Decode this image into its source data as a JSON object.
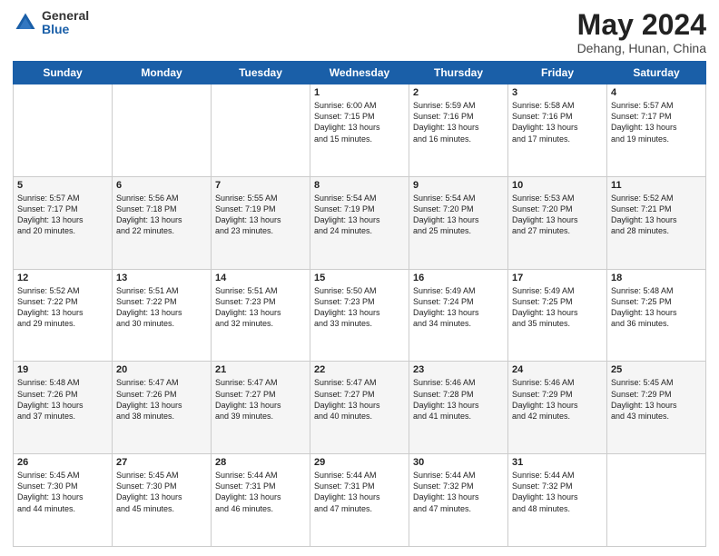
{
  "header": {
    "logo_general": "General",
    "logo_blue": "Blue",
    "month_year": "May 2024",
    "location": "Dehang, Hunan, China"
  },
  "days_of_week": [
    "Sunday",
    "Monday",
    "Tuesday",
    "Wednesday",
    "Thursday",
    "Friday",
    "Saturday"
  ],
  "weeks": [
    [
      {
        "day": "",
        "info": ""
      },
      {
        "day": "",
        "info": ""
      },
      {
        "day": "",
        "info": ""
      },
      {
        "day": "1",
        "info": "Sunrise: 6:00 AM\nSunset: 7:15 PM\nDaylight: 13 hours\nand 15 minutes."
      },
      {
        "day": "2",
        "info": "Sunrise: 5:59 AM\nSunset: 7:16 PM\nDaylight: 13 hours\nand 16 minutes."
      },
      {
        "day": "3",
        "info": "Sunrise: 5:58 AM\nSunset: 7:16 PM\nDaylight: 13 hours\nand 17 minutes."
      },
      {
        "day": "4",
        "info": "Sunrise: 5:57 AM\nSunset: 7:17 PM\nDaylight: 13 hours\nand 19 minutes."
      }
    ],
    [
      {
        "day": "5",
        "info": "Sunrise: 5:57 AM\nSunset: 7:17 PM\nDaylight: 13 hours\nand 20 minutes."
      },
      {
        "day": "6",
        "info": "Sunrise: 5:56 AM\nSunset: 7:18 PM\nDaylight: 13 hours\nand 22 minutes."
      },
      {
        "day": "7",
        "info": "Sunrise: 5:55 AM\nSunset: 7:19 PM\nDaylight: 13 hours\nand 23 minutes."
      },
      {
        "day": "8",
        "info": "Sunrise: 5:54 AM\nSunset: 7:19 PM\nDaylight: 13 hours\nand 24 minutes."
      },
      {
        "day": "9",
        "info": "Sunrise: 5:54 AM\nSunset: 7:20 PM\nDaylight: 13 hours\nand 25 minutes."
      },
      {
        "day": "10",
        "info": "Sunrise: 5:53 AM\nSunset: 7:20 PM\nDaylight: 13 hours\nand 27 minutes."
      },
      {
        "day": "11",
        "info": "Sunrise: 5:52 AM\nSunset: 7:21 PM\nDaylight: 13 hours\nand 28 minutes."
      }
    ],
    [
      {
        "day": "12",
        "info": "Sunrise: 5:52 AM\nSunset: 7:22 PM\nDaylight: 13 hours\nand 29 minutes."
      },
      {
        "day": "13",
        "info": "Sunrise: 5:51 AM\nSunset: 7:22 PM\nDaylight: 13 hours\nand 30 minutes."
      },
      {
        "day": "14",
        "info": "Sunrise: 5:51 AM\nSunset: 7:23 PM\nDaylight: 13 hours\nand 32 minutes."
      },
      {
        "day": "15",
        "info": "Sunrise: 5:50 AM\nSunset: 7:23 PM\nDaylight: 13 hours\nand 33 minutes."
      },
      {
        "day": "16",
        "info": "Sunrise: 5:49 AM\nSunset: 7:24 PM\nDaylight: 13 hours\nand 34 minutes."
      },
      {
        "day": "17",
        "info": "Sunrise: 5:49 AM\nSunset: 7:25 PM\nDaylight: 13 hours\nand 35 minutes."
      },
      {
        "day": "18",
        "info": "Sunrise: 5:48 AM\nSunset: 7:25 PM\nDaylight: 13 hours\nand 36 minutes."
      }
    ],
    [
      {
        "day": "19",
        "info": "Sunrise: 5:48 AM\nSunset: 7:26 PM\nDaylight: 13 hours\nand 37 minutes."
      },
      {
        "day": "20",
        "info": "Sunrise: 5:47 AM\nSunset: 7:26 PM\nDaylight: 13 hours\nand 38 minutes."
      },
      {
        "day": "21",
        "info": "Sunrise: 5:47 AM\nSunset: 7:27 PM\nDaylight: 13 hours\nand 39 minutes."
      },
      {
        "day": "22",
        "info": "Sunrise: 5:47 AM\nSunset: 7:27 PM\nDaylight: 13 hours\nand 40 minutes."
      },
      {
        "day": "23",
        "info": "Sunrise: 5:46 AM\nSunset: 7:28 PM\nDaylight: 13 hours\nand 41 minutes."
      },
      {
        "day": "24",
        "info": "Sunrise: 5:46 AM\nSunset: 7:29 PM\nDaylight: 13 hours\nand 42 minutes."
      },
      {
        "day": "25",
        "info": "Sunrise: 5:45 AM\nSunset: 7:29 PM\nDaylight: 13 hours\nand 43 minutes."
      }
    ],
    [
      {
        "day": "26",
        "info": "Sunrise: 5:45 AM\nSunset: 7:30 PM\nDaylight: 13 hours\nand 44 minutes."
      },
      {
        "day": "27",
        "info": "Sunrise: 5:45 AM\nSunset: 7:30 PM\nDaylight: 13 hours\nand 45 minutes."
      },
      {
        "day": "28",
        "info": "Sunrise: 5:44 AM\nSunset: 7:31 PM\nDaylight: 13 hours\nand 46 minutes."
      },
      {
        "day": "29",
        "info": "Sunrise: 5:44 AM\nSunset: 7:31 PM\nDaylight: 13 hours\nand 47 minutes."
      },
      {
        "day": "30",
        "info": "Sunrise: 5:44 AM\nSunset: 7:32 PM\nDaylight: 13 hours\nand 47 minutes."
      },
      {
        "day": "31",
        "info": "Sunrise: 5:44 AM\nSunset: 7:32 PM\nDaylight: 13 hours\nand 48 minutes."
      },
      {
        "day": "",
        "info": ""
      }
    ]
  ]
}
